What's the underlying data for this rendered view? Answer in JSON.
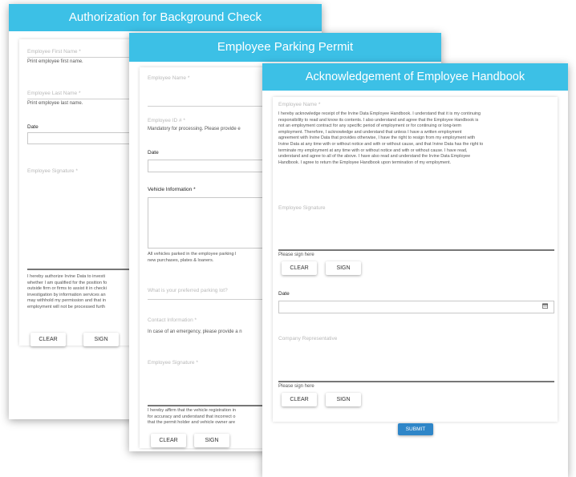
{
  "forms": {
    "background": {
      "title": "Authorization for Background Check",
      "first_name_label": "Employee First Name *",
      "first_name_hint": "Print employee first name.",
      "last_name_label": "Employee Last Name *",
      "last_name_hint": "Print employee last name.",
      "date_label": "Date",
      "signature_label": "Employee Signature *",
      "authorization_lines": [
        "I hereby authorize Irvine Data to investi",
        "whether I am qualified for the position fo",
        "outside firm or firms to assist it in checki",
        "investigation by information services an",
        "may withhold my permission and that in",
        "employment will not be processed furth"
      ],
      "clear_label": "CLEAR",
      "sign_label": "SIGN"
    },
    "parking": {
      "title": "Employee Parking Permit",
      "name_label": "Employee Name *",
      "id_label": "Employee ID # *",
      "id_hint": "Mandatory for processing. Please provide e",
      "date_label": "Date",
      "vehicle_label": "Vehicle Information *",
      "vehicle_note_lines": [
        "All vehicles parked in the employee parking l",
        "new purchases, plates & loaners."
      ],
      "spot_label": "What is your preferred parking lot?",
      "contact_label": "Contact Information *",
      "contact_hint": "In case of an emergency, please provide a n",
      "signature_label": "Employee Signature *",
      "affirm_lines": [
        "I hereby affirm that the vehicle registration in",
        "for accuracy and understand that incorrect o",
        "that the permit holder and vehicle owner are"
      ],
      "clear_label": "CLEAR",
      "sign_label": "SIGN"
    },
    "handbook": {
      "title": "Acknowledgement of Employee Handbook",
      "name_label": "Employee Name *",
      "ack_lines": [
        "I hereby acknowledge receipt of the Irvine Data Employee Handbook. I understand that it is my continuing",
        "responsibility to read and know its contents. I also understand and agree that the Employee Handbook is",
        "not an employment contract for any specific period of employment or for continuing or long-term",
        "employment. Therefore, I acknowledge and understand that unless I have a written employment",
        "agreement with Irvine Data that provides otherwise, I have the right to resign from my employment with",
        "Irvine Data at any time with or without notice and with or without cause, and that Irvine Data has the right to",
        "terminate my employment at any time with or without notice and with or without cause. I have read,",
        "understand and agree to all of the above. I have also read and understand the Irvine Data Employee",
        "Handbook. I agree to return the Employee Handbook upon termination of my employment."
      ],
      "signature_label": "Employee Signature",
      "sign_hint": "Please sign here",
      "clear_label": "CLEAR",
      "sign_label": "SIGN",
      "date_label": "Date",
      "rep_label": "Company Representative",
      "rep_sign_hint": "Please sign here",
      "rep_clear_label": "CLEAR",
      "rep_sign_label": "SIGN",
      "submit_label": "SUBMIT"
    }
  },
  "colors": {
    "header": "#3cc0e6",
    "submit": "#2f86c8"
  },
  "icons": {
    "date_picker": "calendar-icon"
  }
}
